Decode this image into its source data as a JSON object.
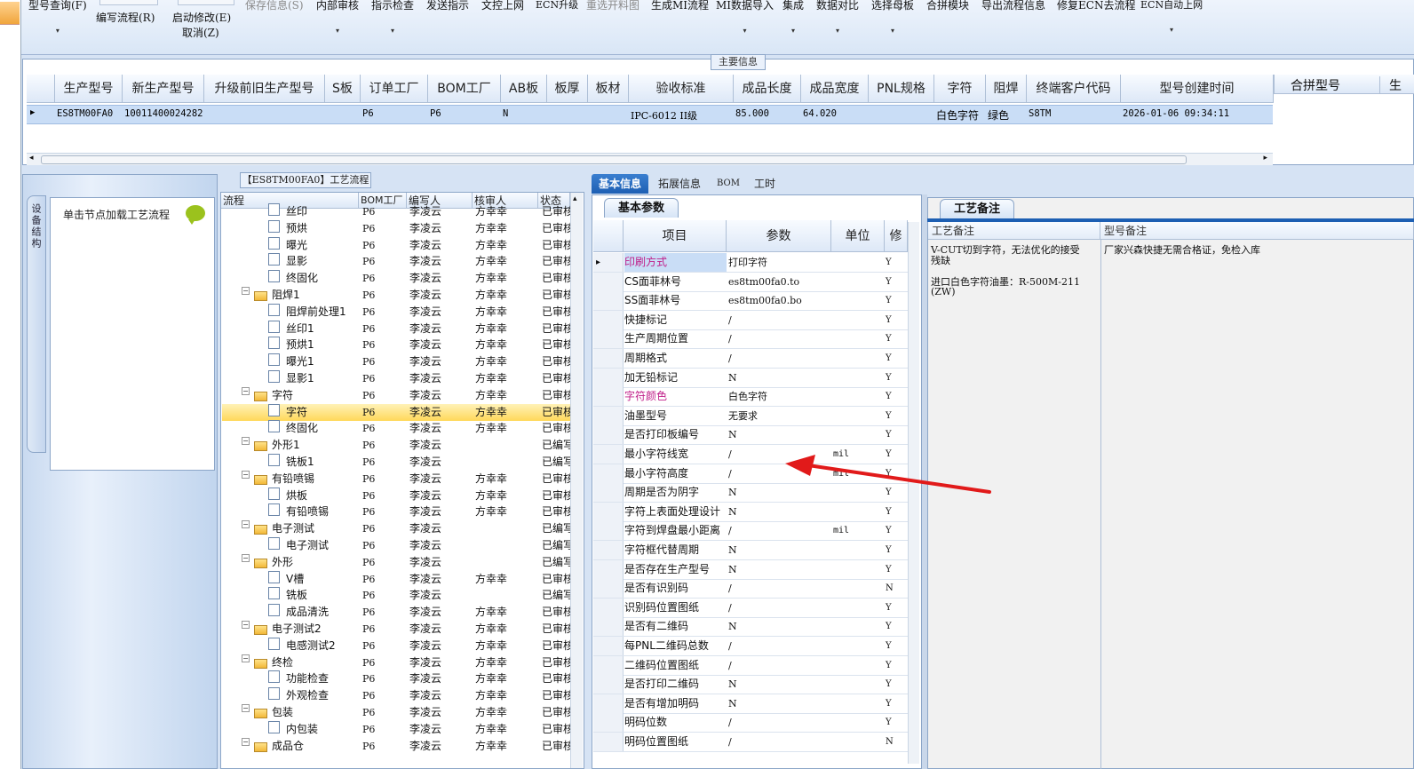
{
  "toolbar": {
    "buttons": [
      {
        "label": "型号查询(F)",
        "disabled": false
      },
      {
        "label": "编写流程(R)",
        "disabled": false
      },
      {
        "label": "启动修改(E)",
        "disabled": false
      },
      {
        "label": "取消(Z)",
        "disabled": false
      },
      {
        "label": "保存信息(S)",
        "disabled": true
      },
      {
        "label": "内部审核",
        "disabled": false
      },
      {
        "label": "指示检查",
        "disabled": false
      },
      {
        "label": "发送指示",
        "disabled": false
      },
      {
        "label": "文控上网",
        "disabled": false
      },
      {
        "label": "ECN升级",
        "disabled": false
      },
      {
        "label": "重选开料图",
        "disabled": true
      },
      {
        "label": "生成MI流程",
        "disabled": false
      },
      {
        "label": "MI数据导入",
        "disabled": false
      },
      {
        "label": "集成",
        "disabled": false
      },
      {
        "label": "数据对比",
        "disabled": false
      },
      {
        "label": "选择母板",
        "disabled": false
      },
      {
        "label": "合拼模块",
        "disabled": false
      },
      {
        "label": "导出流程信息",
        "disabled": false
      },
      {
        "label": "修复ECN去流程",
        "disabled": false
      },
      {
        "label": "ECN自动上网",
        "disabled": false
      }
    ]
  },
  "main_info": {
    "legend": "主要信息",
    "columns": [
      "生产型号",
      "新生产型号",
      "升级前旧生产型号",
      "S板",
      "订单工厂",
      "BOM工厂",
      "AB板",
      "板厚",
      "板材",
      "验收标准",
      "成品长度",
      "成品宽度",
      "PNL规格",
      "字符",
      "阻焊",
      "终端客户代码",
      "型号创建时间"
    ],
    "row": [
      "ES8TM00FA0",
      "10011400024282",
      "",
      "",
      "P6",
      "P6",
      "N",
      "",
      "",
      "IPC-6012 II级",
      "85.000",
      "64.020",
      "",
      "白色字符",
      "绿色",
      "S8TM",
      "2026-01-06 09:34:11"
    ],
    "merge_columns": [
      "合拼型号",
      "生"
    ]
  },
  "left_panel": {
    "vertical_tab": "设备结构",
    "node_hint": "单击节点加载工艺流程"
  },
  "flow": {
    "title": "【ES8TM00FA0】工艺流程",
    "columns": [
      "流程",
      "BOM工厂",
      "编写人",
      "核审人",
      "状态"
    ],
    "rows": [
      {
        "name": "丝印",
        "level": 2,
        "type": "doc",
        "bom": "P6",
        "writer": "李凌云",
        "reviewer": "方幸幸",
        "status": "已审核"
      },
      {
        "name": "预烘",
        "level": 2,
        "type": "doc",
        "bom": "P6",
        "writer": "李凌云",
        "reviewer": "方幸幸",
        "status": "已审核"
      },
      {
        "name": "曝光",
        "level": 2,
        "type": "doc",
        "bom": "P6",
        "writer": "李凌云",
        "reviewer": "方幸幸",
        "status": "已审核"
      },
      {
        "name": "显影",
        "level": 2,
        "type": "doc",
        "bom": "P6",
        "writer": "李凌云",
        "reviewer": "方幸幸",
        "status": "已审核"
      },
      {
        "name": "终固化",
        "level": 2,
        "type": "doc",
        "bom": "P6",
        "writer": "李凌云",
        "reviewer": "方幸幸",
        "status": "已审核"
      },
      {
        "name": "阻焊1",
        "level": 1,
        "type": "folder",
        "bom": "P6",
        "writer": "李凌云",
        "reviewer": "方幸幸",
        "status": "已审核"
      },
      {
        "name": "阻焊前处理1",
        "level": 2,
        "type": "doc",
        "bom": "P6",
        "writer": "李凌云",
        "reviewer": "方幸幸",
        "status": "已审核"
      },
      {
        "name": "丝印1",
        "level": 2,
        "type": "doc",
        "bom": "P6",
        "writer": "李凌云",
        "reviewer": "方幸幸",
        "status": "已审核"
      },
      {
        "name": "预烘1",
        "level": 2,
        "type": "doc",
        "bom": "P6",
        "writer": "李凌云",
        "reviewer": "方幸幸",
        "status": "已审核"
      },
      {
        "name": "曝光1",
        "level": 2,
        "type": "doc",
        "bom": "P6",
        "writer": "李凌云",
        "reviewer": "方幸幸",
        "status": "已审核"
      },
      {
        "name": "显影1",
        "level": 2,
        "type": "doc",
        "bom": "P6",
        "writer": "李凌云",
        "reviewer": "方幸幸",
        "status": "已审核"
      },
      {
        "name": "字符",
        "level": 1,
        "type": "folder",
        "bom": "P6",
        "writer": "李凌云",
        "reviewer": "方幸幸",
        "status": "已审核"
      },
      {
        "name": "字符",
        "level": 2,
        "type": "doc",
        "bom": "P6",
        "writer": "李凌云",
        "reviewer": "方幸幸",
        "status": "已审核",
        "selected": true
      },
      {
        "name": "终固化",
        "level": 2,
        "type": "doc",
        "bom": "P6",
        "writer": "李凌云",
        "reviewer": "方幸幸",
        "status": "已审核"
      },
      {
        "name": "外形1",
        "level": 1,
        "type": "folder",
        "bom": "P6",
        "writer": "李凌云",
        "reviewer": "",
        "status": "已编写"
      },
      {
        "name": "铣板1",
        "level": 2,
        "type": "doc",
        "bom": "P6",
        "writer": "李凌云",
        "reviewer": "",
        "status": "已编写"
      },
      {
        "name": "有铅喷锡",
        "level": 1,
        "type": "folder",
        "bom": "P6",
        "writer": "李凌云",
        "reviewer": "方幸幸",
        "status": "已审核"
      },
      {
        "name": "烘板",
        "level": 2,
        "type": "doc",
        "bom": "P6",
        "writer": "李凌云",
        "reviewer": "方幸幸",
        "status": "已审核"
      },
      {
        "name": "有铅喷锡",
        "level": 2,
        "type": "doc",
        "bom": "P6",
        "writer": "李凌云",
        "reviewer": "方幸幸",
        "status": "已审核"
      },
      {
        "name": "电子测试",
        "level": 1,
        "type": "folder",
        "bom": "P6",
        "writer": "李凌云",
        "reviewer": "",
        "status": "已编写"
      },
      {
        "name": "电子测试",
        "level": 2,
        "type": "doc",
        "bom": "P6",
        "writer": "李凌云",
        "reviewer": "",
        "status": "已编写"
      },
      {
        "name": "外形",
        "level": 1,
        "type": "folder",
        "bom": "P6",
        "writer": "李凌云",
        "reviewer": "",
        "status": "已编写"
      },
      {
        "name": "V槽",
        "level": 2,
        "type": "doc",
        "bom": "P6",
        "writer": "李凌云",
        "reviewer": "方幸幸",
        "status": "已审核"
      },
      {
        "name": "铣板",
        "level": 2,
        "type": "doc",
        "bom": "P6",
        "writer": "李凌云",
        "reviewer": "",
        "status": "已编写"
      },
      {
        "name": "成品清洗",
        "level": 2,
        "type": "doc",
        "bom": "P6",
        "writer": "李凌云",
        "reviewer": "方幸幸",
        "status": "已审核"
      },
      {
        "name": "电子测试2",
        "level": 1,
        "type": "folder",
        "bom": "P6",
        "writer": "李凌云",
        "reviewer": "方幸幸",
        "status": "已审核"
      },
      {
        "name": "电感测试2",
        "level": 2,
        "type": "doc",
        "bom": "P6",
        "writer": "李凌云",
        "reviewer": "方幸幸",
        "status": "已审核"
      },
      {
        "name": "终检",
        "level": 1,
        "type": "folder",
        "bom": "P6",
        "writer": "李凌云",
        "reviewer": "方幸幸",
        "status": "已审核"
      },
      {
        "name": "功能检查",
        "level": 2,
        "type": "doc",
        "bom": "P6",
        "writer": "李凌云",
        "reviewer": "方幸幸",
        "status": "已审核"
      },
      {
        "name": "外观检查",
        "level": 2,
        "type": "doc",
        "bom": "P6",
        "writer": "李凌云",
        "reviewer": "方幸幸",
        "status": "已审核"
      },
      {
        "name": "包装",
        "level": 1,
        "type": "folder",
        "bom": "P6",
        "writer": "李凌云",
        "reviewer": "方幸幸",
        "status": "已审核"
      },
      {
        "name": "内包装",
        "level": 2,
        "type": "doc",
        "bom": "P6",
        "writer": "李凌云",
        "reviewer": "方幸幸",
        "status": "已审核"
      },
      {
        "name": "成品仓",
        "level": 1,
        "type": "folder",
        "bom": "P6",
        "writer": "李凌云",
        "reviewer": "方幸幸",
        "status": "已审核"
      }
    ]
  },
  "detail_tabs": [
    "基本信息",
    "拓展信息",
    "BOM",
    "工时"
  ],
  "basic_params": {
    "tab": "基本参数",
    "columns": [
      "项目",
      "参数",
      "单位",
      "修"
    ],
    "rows": [
      {
        "k": "印刷方式",
        "v": "打印字符",
        "u": "",
        "y": "Y",
        "pink": true
      },
      {
        "k": "CS面菲林号",
        "v": "es8tm00fa0.to",
        "u": "",
        "y": "Y"
      },
      {
        "k": "SS面菲林号",
        "v": "es8tm00fa0.bo",
        "u": "",
        "y": "Y"
      },
      {
        "k": "快捷标记",
        "v": "/",
        "u": "",
        "y": "Y"
      },
      {
        "k": "生产周期位置",
        "v": "/",
        "u": "",
        "y": "Y"
      },
      {
        "k": "周期格式",
        "v": "/",
        "u": "",
        "y": "Y"
      },
      {
        "k": "加无铅标记",
        "v": "N",
        "u": "",
        "y": "Y"
      },
      {
        "k": "字符颜色",
        "v": "白色字符",
        "u": "",
        "y": "Y",
        "pink": true
      },
      {
        "k": "油墨型号",
        "v": "无要求",
        "u": "",
        "y": "Y"
      },
      {
        "k": "是否打印板编号",
        "v": "N",
        "u": "",
        "y": "Y"
      },
      {
        "k": "最小字符线宽",
        "v": "/",
        "u": "mil",
        "y": "Y"
      },
      {
        "k": "最小字符高度",
        "v": "/",
        "u": "mil",
        "y": "Y"
      },
      {
        "k": "周期是否为阴字",
        "v": "N",
        "u": "",
        "y": "Y"
      },
      {
        "k": "字符上表面处理设计",
        "v": "N",
        "u": "",
        "y": "Y"
      },
      {
        "k": "字符到焊盘最小距离",
        "v": "/",
        "u": "mil",
        "y": "Y"
      },
      {
        "k": "字符框代替周期",
        "v": "N",
        "u": "",
        "y": "Y"
      },
      {
        "k": "是否存在生产型号",
        "v": "N",
        "u": "",
        "y": "Y"
      },
      {
        "k": "是否有识别码",
        "v": "/",
        "u": "",
        "y": "N"
      },
      {
        "k": "识别码位置图纸",
        "v": "/",
        "u": "",
        "y": "Y"
      },
      {
        "k": "是否有二维码",
        "v": "N",
        "u": "",
        "y": "Y"
      },
      {
        "k": "每PNL二维码总数",
        "v": "/",
        "u": "",
        "y": "Y"
      },
      {
        "k": "二维码位置图纸",
        "v": "/",
        "u": "",
        "y": "Y"
      },
      {
        "k": "是否打印二维码",
        "v": "N",
        "u": "",
        "y": "Y"
      },
      {
        "k": "是否有增加明码",
        "v": "N",
        "u": "",
        "y": "Y"
      },
      {
        "k": "明码位数",
        "v": "/",
        "u": "",
        "y": "Y"
      },
      {
        "k": "明码位置图纸",
        "v": "/",
        "u": "",
        "y": "N"
      }
    ]
  },
  "craft_notes": {
    "tab": "工艺备注",
    "col1": "工艺备注",
    "col2": "型号备注",
    "note1_line1": "V-CUT切到字符，无法优化的接受",
    "note1_line2": "残缺",
    "note1_line3": "进口白色字符油墨：R-500M-211",
    "note1_line4": "(ZW)",
    "note2": "厂家兴森快捷无需合格证，免检入库"
  },
  "colors": {
    "accent": "#1d5fb3",
    "selected_row": "#c9ddf6",
    "tree_selected": "#ffd85a",
    "annotation_arrow": "#e11a1a"
  }
}
